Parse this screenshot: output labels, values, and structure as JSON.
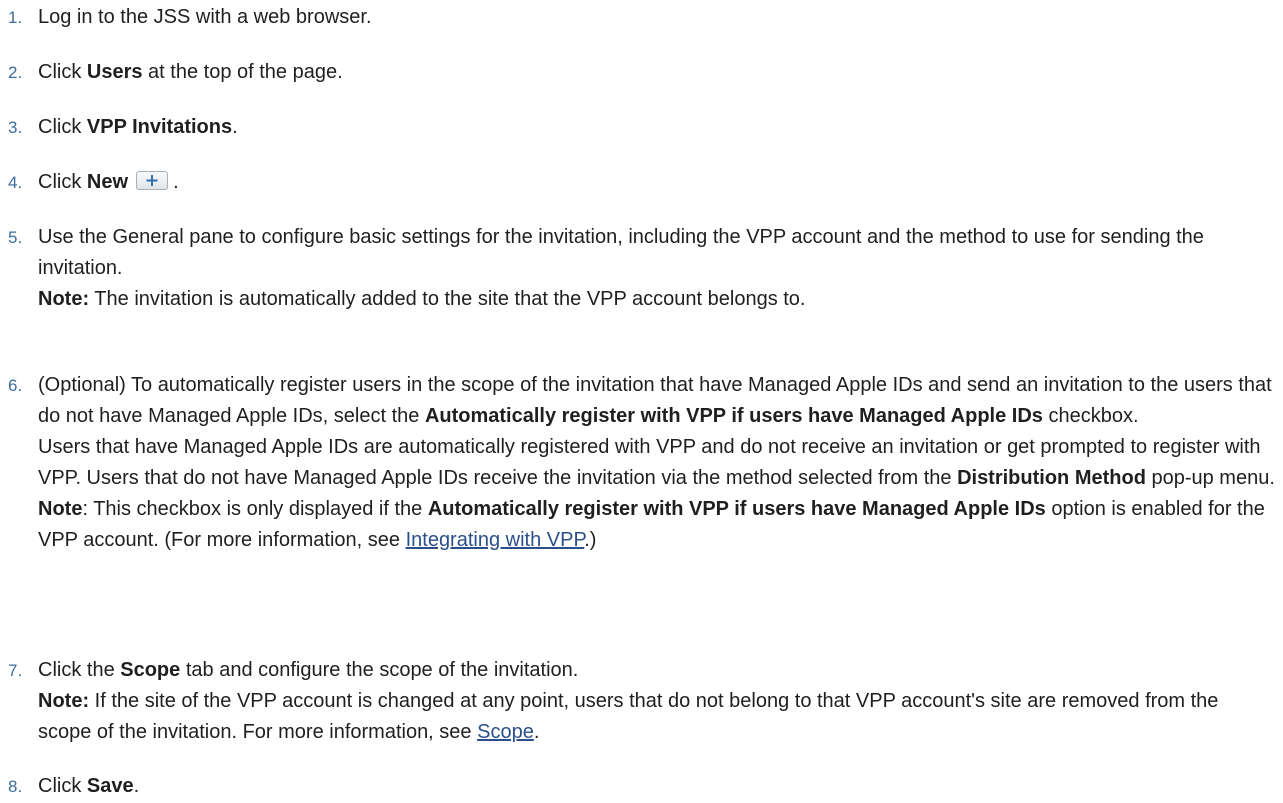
{
  "steps": [
    {
      "num": "1.",
      "t1": "Log in to the JSS with a web browser."
    },
    {
      "num": "2.",
      "t1": "Click ",
      "b1": "Users",
      "t2": " at the top of the page."
    },
    {
      "num": "3.",
      "t1": "Click ",
      "b1": "VPP Invitations",
      "t2": "."
    },
    {
      "num": "4.",
      "t1": "Click ",
      "b1": "New",
      "t2": " .",
      "icon": "plus-icon"
    },
    {
      "num": "5.",
      "t1": "Use the General pane to configure basic settings for the invitation, including the VPP account and the method to use for sending the invitation.",
      "note_label": "Note:",
      "note_text": " The invitation is automatically added to the site that the VPP account belongs to."
    },
    {
      "num": "6.",
      "t1": "(Optional) To automatically register users in the scope of the invitation that have Managed Apple IDs and send an invitation to the users that do not have Managed Apple IDs, select the ",
      "b1": "Automatically register with VPP if users have Managed Apple IDs",
      "t2": " checkbox.",
      "p2a": "Users that have Managed Apple IDs are automatically registered with VPP and do not receive an invitation or get prompted to register with VPP. Users that do not have Managed Apple IDs receive the invitation via the method selected from the ",
      "p2b": "Distribution Method",
      "p2c": " pop-up menu.",
      "note_label": "Note",
      "n1": ": This checkbox is only displayed if the ",
      "n2": "Automatically register with VPP if users have Managed Apple IDs",
      "n3": " option is enabled for the VPP account. (For more information, see ",
      "link": "Integrating with VPP",
      "n4": ".)"
    },
    {
      "num": "7.",
      "t1": "Click the ",
      "b1": "Scope",
      "t2": " tab and configure the scope of the invitation.",
      "note_label": "Note:",
      "n1": " If the site of the VPP account is changed at any point, users that do not belong to that VPP account's site are removed from the scope of the invitation. For more information, see ",
      "link": "Scope",
      "n2": "."
    },
    {
      "num": "8.",
      "t1": "Click ",
      "b1": "Save",
      "t2": "."
    }
  ],
  "colors": {
    "number": "#3b6e9c",
    "link": "#2a4f8a",
    "text": "#1f1f1f"
  }
}
